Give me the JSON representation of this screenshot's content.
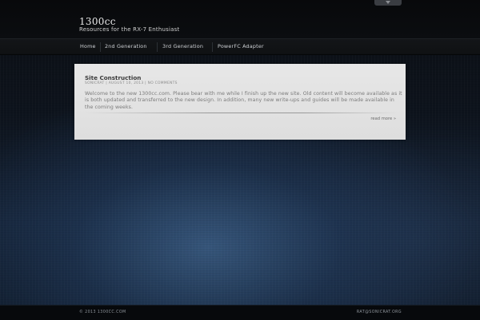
{
  "site": {
    "title": "1300cc",
    "tagline": "Resources for the RX-7 Enthusiast"
  },
  "header": {
    "dropdown_icon": "chevron-down-icon"
  },
  "nav": {
    "items": [
      {
        "label": "Home"
      },
      {
        "label": "2nd Generation"
      },
      {
        "label": "3rd Generation"
      },
      {
        "label": "PowerFC Adapter"
      }
    ]
  },
  "post": {
    "title": "Site Construction",
    "author": "SONICRAT",
    "date": "AUGUST 10, 2013",
    "comments": "NO COMMENTS",
    "body": "Welcome to the new 1300cc.com. Please bear with me while I finish up the new site. Old content will become available as it is both updated and transferred to the new design. In addition, many new write-ups and guides will be made available in the coming weeks.",
    "read_more": "read more »"
  },
  "footer": {
    "copyright": "© 2013 1300CC.COM",
    "email": "RAT@SONICRAT.ORG"
  },
  "colors": {
    "post_background": "#e4e4e4",
    "header_background": "#0a0c0f",
    "nav_text": "#cfd2d6"
  }
}
